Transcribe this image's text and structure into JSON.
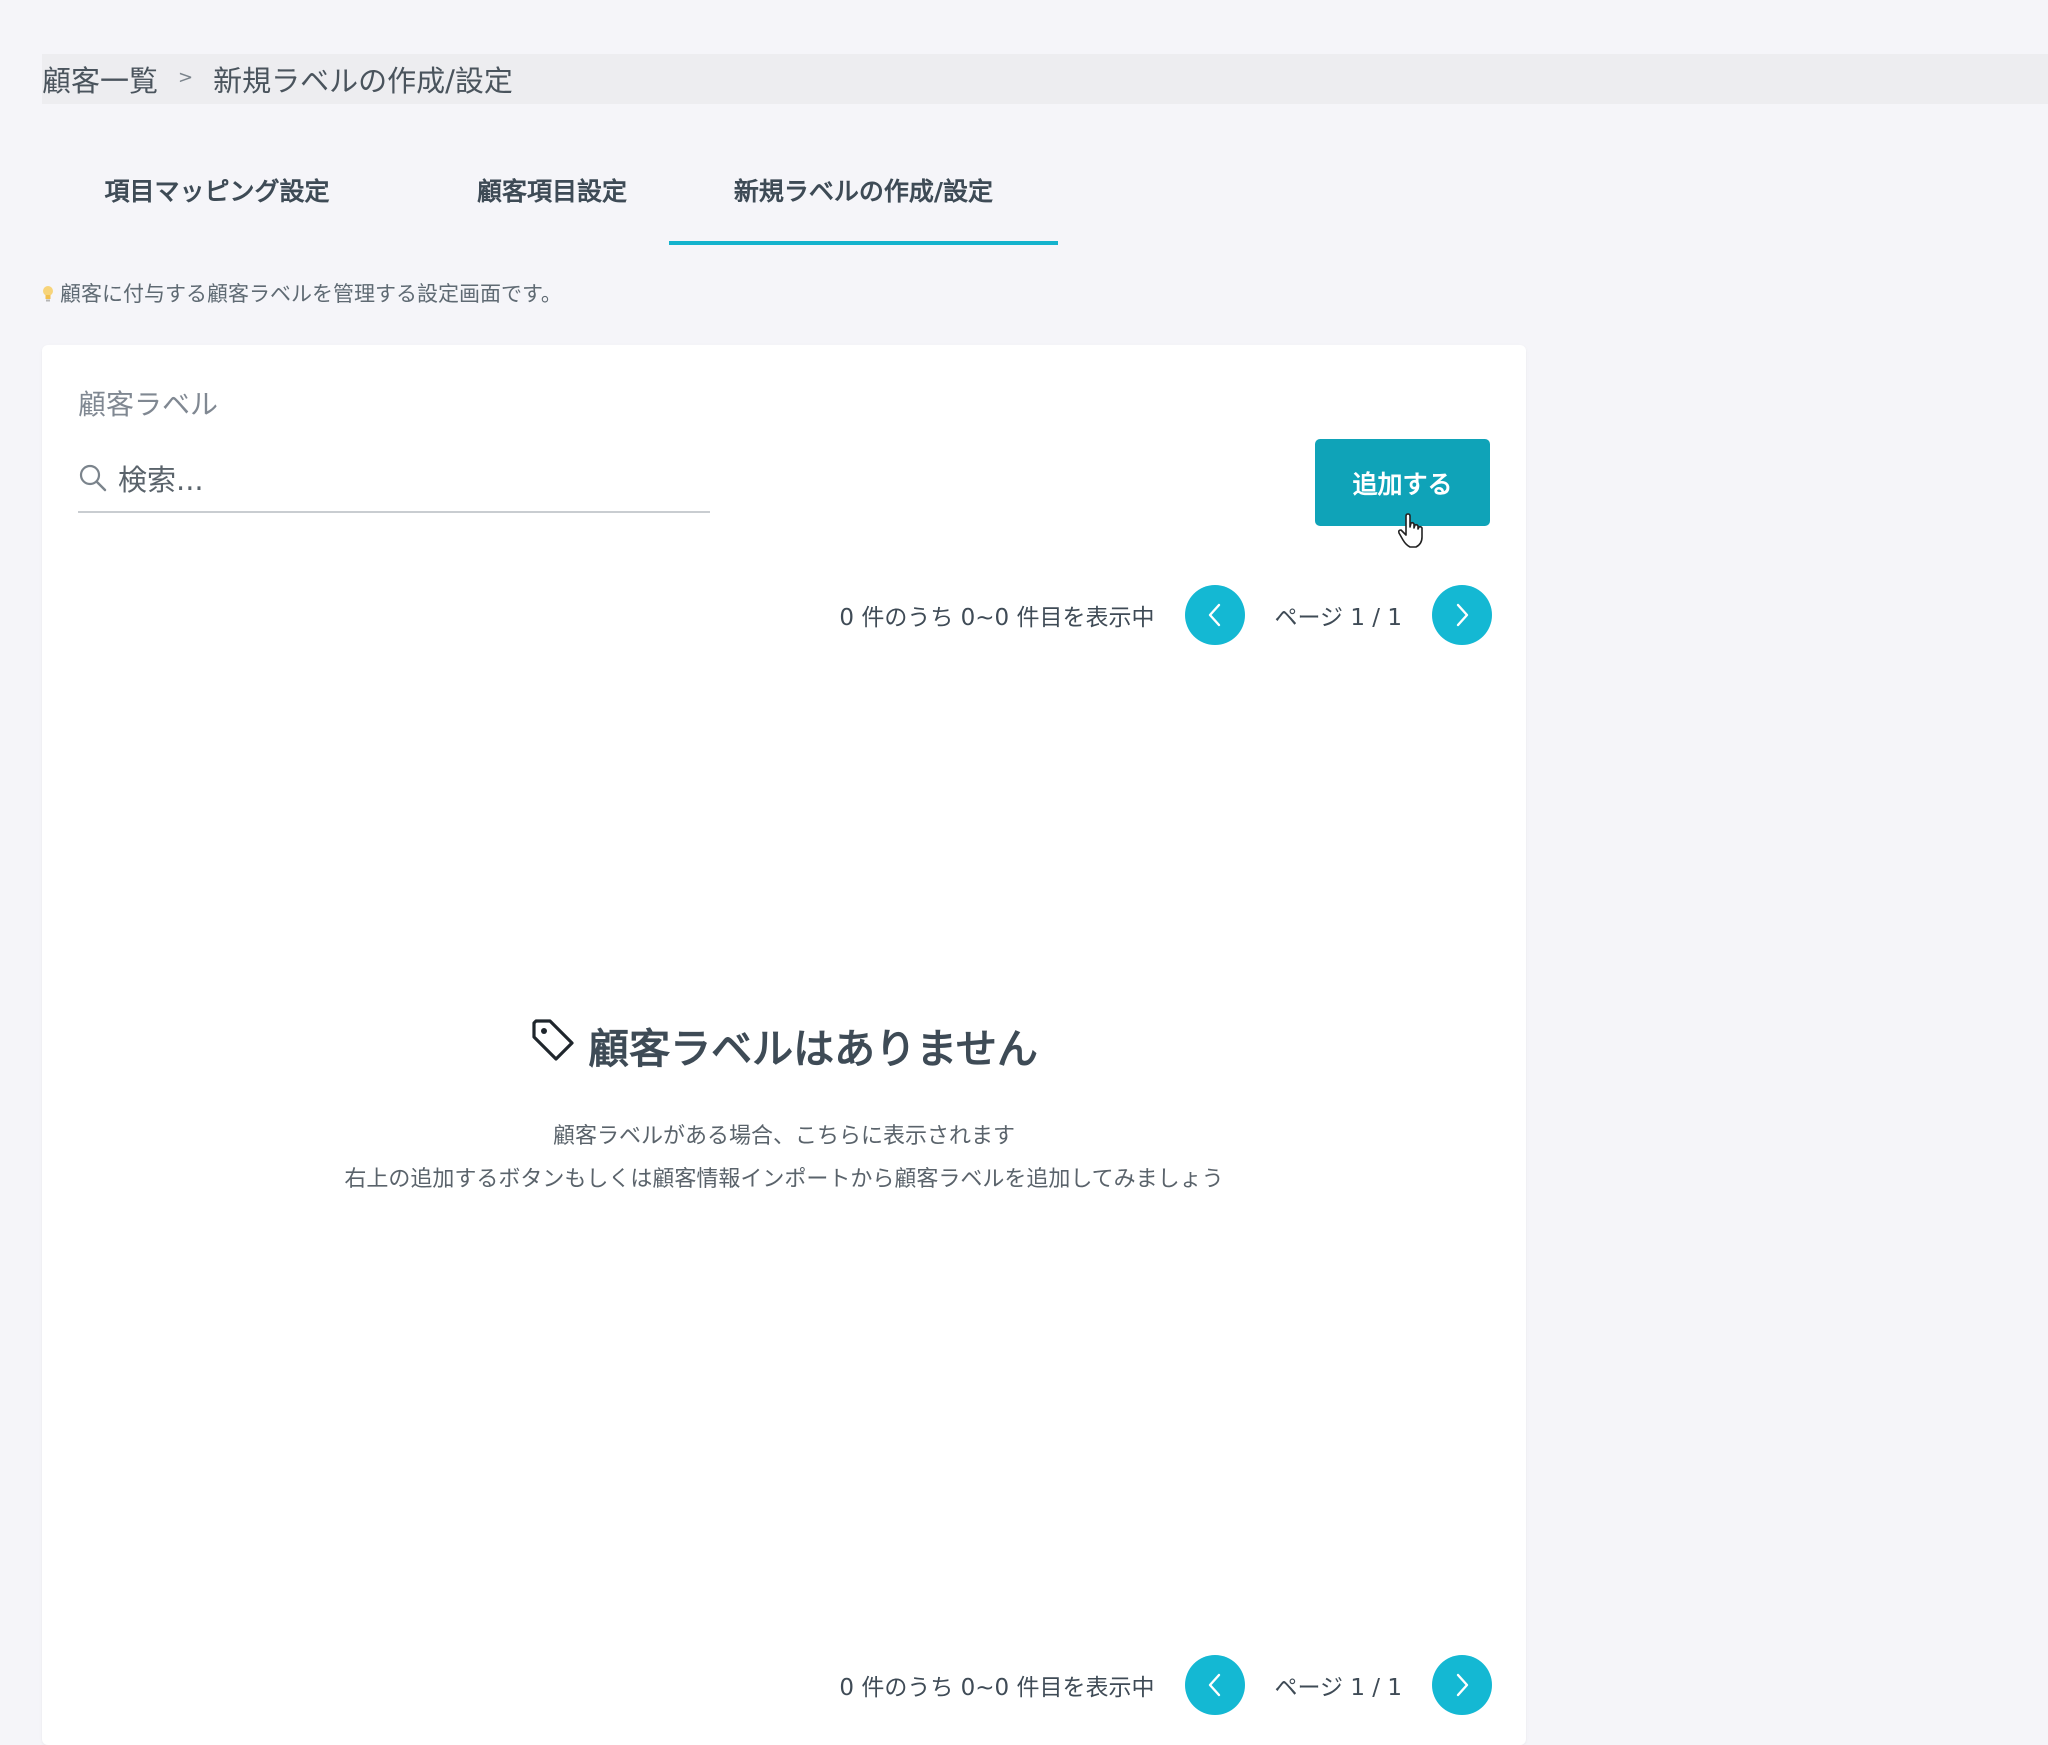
{
  "breadcrumb": {
    "items": [
      "顧客一覧",
      "新規ラベルの作成/設定"
    ],
    "separator": ">"
  },
  "tabs": [
    {
      "label": "項目マッピング設定",
      "active": false
    },
    {
      "label": "顧客項目設定",
      "active": false
    },
    {
      "label": "新規ラベルの作成/設定",
      "active": true
    }
  ],
  "hint": {
    "icon": "lightbulb-icon",
    "text": "顧客に付与する顧客ラベルを管理する設定画面です。"
  },
  "card": {
    "title": "顧客ラベル",
    "search": {
      "placeholder": "検索...",
      "value": "",
      "icon": "search-icon"
    },
    "add_button": "追加する",
    "pager_top": {
      "count_text": "0 件のうち 0~0 件目を表示中",
      "page_text": "ページ 1 / 1"
    },
    "pager_bottom": {
      "count_text": "0 件のうち 0~0 件目を表示中",
      "page_text": "ページ 1 / 1"
    },
    "empty": {
      "icon": "tag-icon",
      "title": "顧客ラベルはありません",
      "line1": "顧客ラベルがある場合、こちらに表示されます",
      "line2": "右上の追加するボタンもしくは顧客情報インポートから顧客ラベルを追加してみましょう"
    }
  },
  "colors": {
    "accent": "#14b8d3",
    "button": "#0fa3b8",
    "tab_underline": "#14b3cd"
  }
}
